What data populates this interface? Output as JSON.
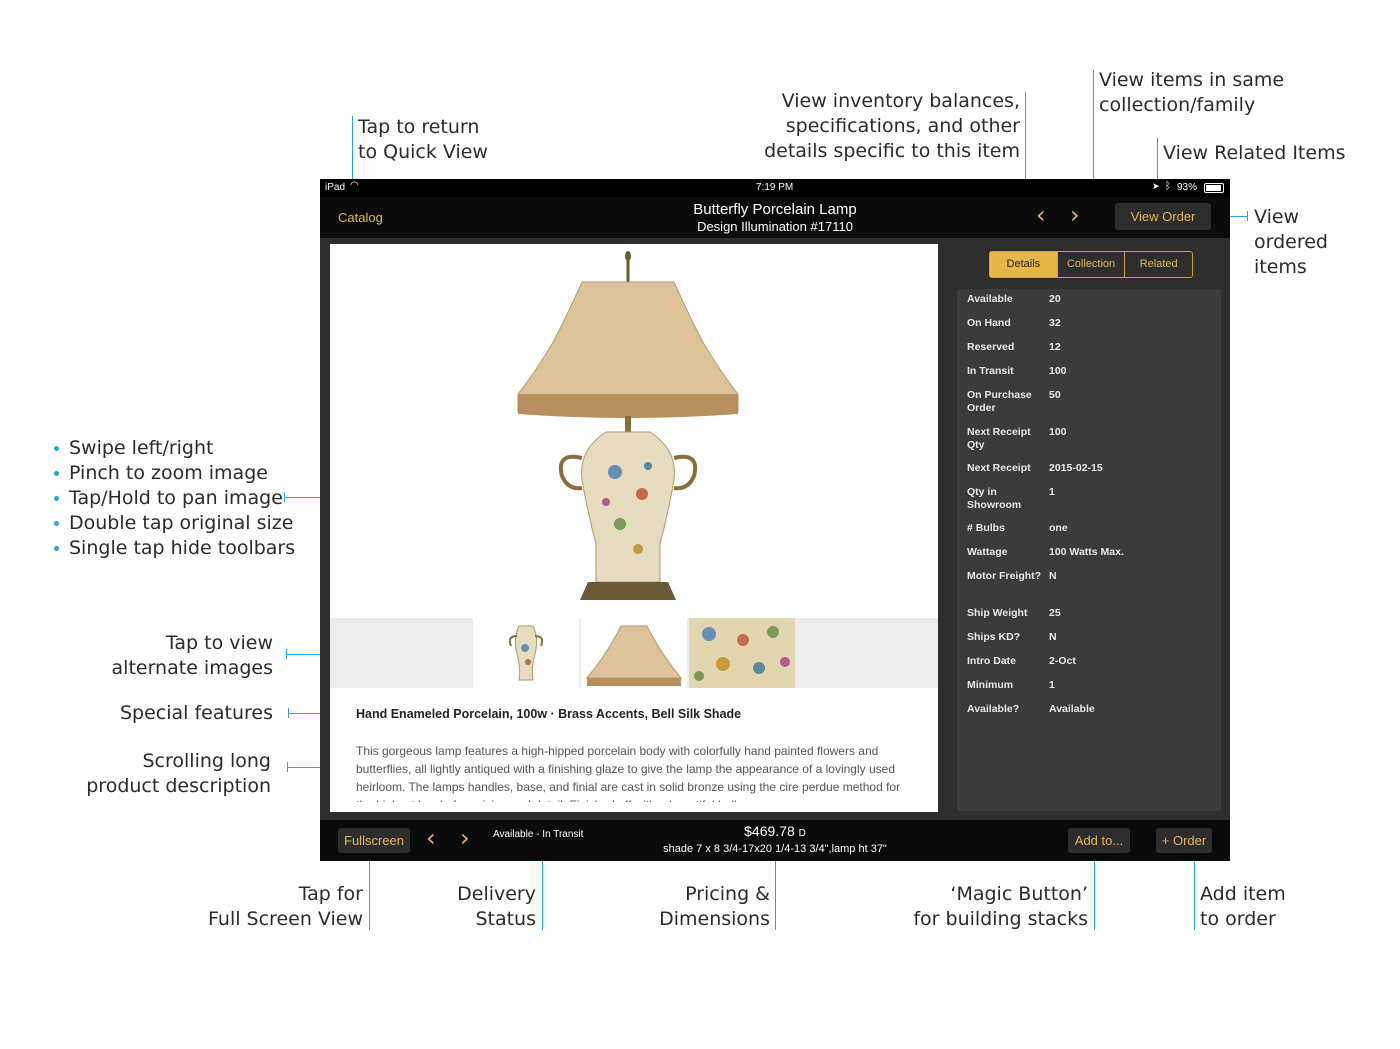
{
  "annotations": {
    "quick_view": "Tap to return\nto Quick View",
    "inventory": "View inventory balances,\nspecifications, and other\ndetails specific to this item",
    "collection": "View items in same\ncollection/family",
    "related": "View Related Items",
    "ordered": "View\nordered\nitems",
    "gestures": [
      "Swipe left/right",
      "Pinch to zoom image",
      "Tap/Hold to pan image",
      "Double tap original size",
      "Single tap hide toolbars"
    ],
    "alternate": "Tap to view\nalternate images",
    "special": "Special features",
    "scrolling": "Scrolling long\nproduct description",
    "fullscreen": "Tap for\nFull Screen View",
    "delivery": "Delivery\nStatus",
    "pricing": "Pricing &\nDimensions",
    "magic": "‘Magic Button’\nfor building stacks",
    "add_item": "Add item\nto order"
  },
  "status_bar": {
    "device": "iPad",
    "time": "7:19 PM",
    "battery": "93%"
  },
  "nav": {
    "back_label": "Catalog",
    "title": "Butterfly Porcelain Lamp",
    "subtitle": "Design Illumination #17110",
    "view_order_label": "View Order"
  },
  "tabs": [
    "Details",
    "Collection",
    "Related"
  ],
  "features": "Hand Enameled Porcelain, 100w · Brass Accents, Bell Silk Shade",
  "description": "This gorgeous lamp features a high-hipped porcelain body with colorfully hand painted flowers and butterflies, all lightly antiqued with a finishing glaze to give the lamp the appearance of a lovingly used heirloom. The lamps handles, base, and finial are cast in solid bronze using the cire perdue method for the highest level of precision and detail. Finished off with a beautiful bell",
  "details": [
    {
      "key": "Available",
      "value": "20"
    },
    {
      "key": "On Hand",
      "value": "32"
    },
    {
      "key": "Reserved",
      "value": "12"
    },
    {
      "key": "In Transit",
      "value": "100"
    },
    {
      "key": "On Purchase Order",
      "value": "50"
    },
    {
      "key": "Next Receipt Qty",
      "value": "100"
    },
    {
      "key": "Next Receipt",
      "value": "2015-02-15"
    },
    {
      "key": "Qty in Showroom",
      "value": "1"
    },
    {
      "key": "# Bulbs",
      "value": "one"
    },
    {
      "key": "Wattage",
      "value": "100 Watts Max."
    },
    {
      "key": "Motor Freight?",
      "value": "N"
    },
    {
      "key": "Ship Weight",
      "value": "25"
    },
    {
      "key": "Ships KD?",
      "value": "N"
    },
    {
      "key": "Intro Date",
      "value": "2-Oct"
    },
    {
      "key": "Minimum",
      "value": "1"
    },
    {
      "key": "Available?",
      "value": "Available"
    }
  ],
  "bottom": {
    "fullscreen_label": "Fullscreen",
    "status": "Available - In Transit",
    "price": "$469.78",
    "price_suffix": "D",
    "dimensions": "shade 7 x 8 3/4-17x20 1/4-13 3/4\",lamp ht 37\"",
    "add_to_label": "Add to...",
    "order_label": "+ Order"
  },
  "colors": {
    "accent": "#29a3d6",
    "gold": "#e3b74b",
    "bar": "#0a0a0a",
    "panel": "#3b3b3b"
  }
}
